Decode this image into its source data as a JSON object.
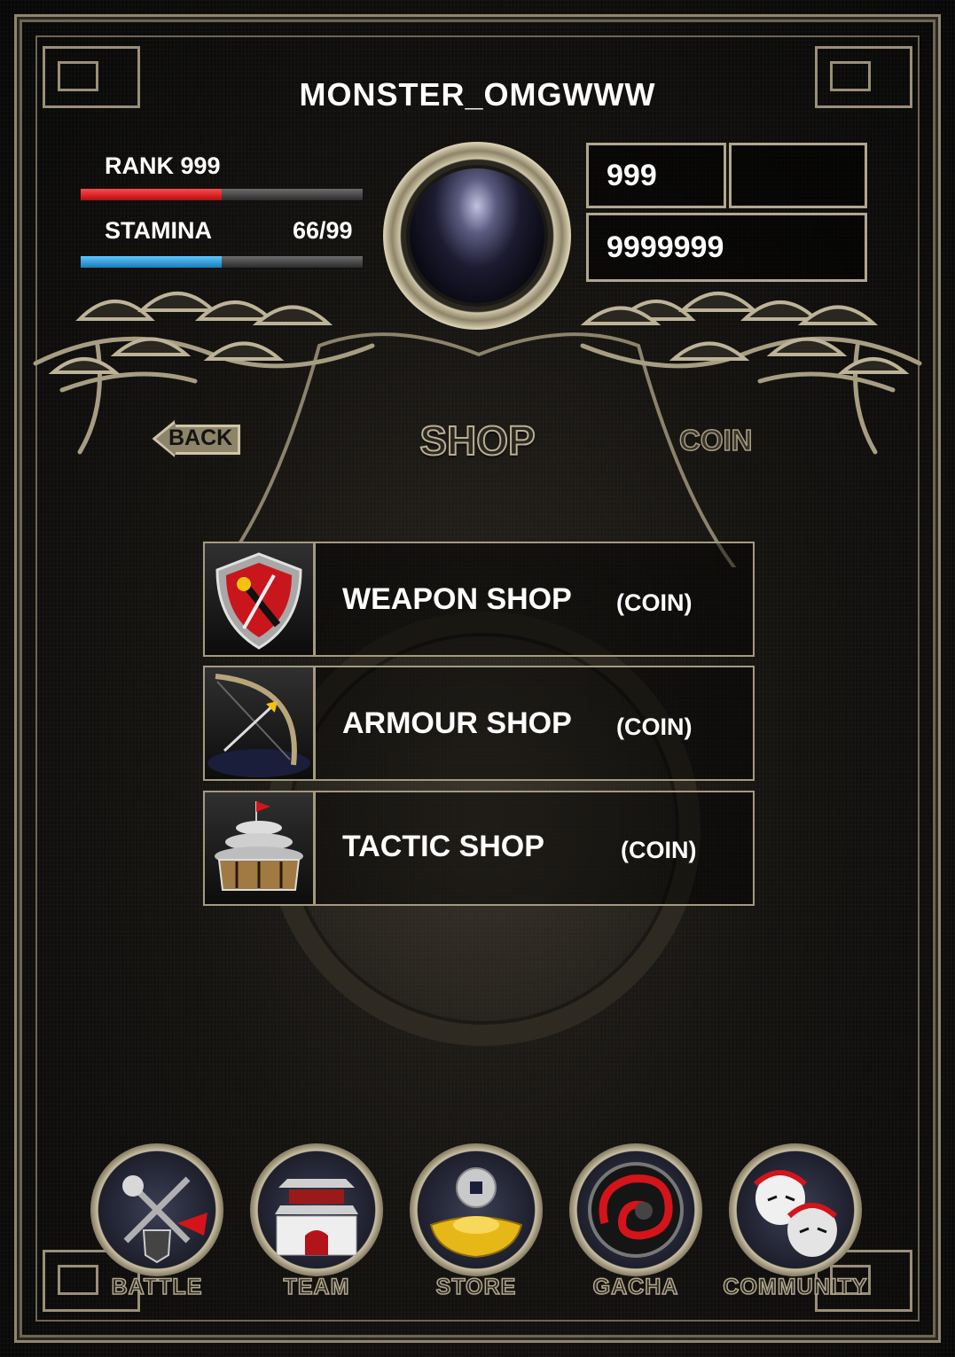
{
  "player": {
    "name": "MONSTER_OMGWWW",
    "rank_label": "RANK 999",
    "rank_progress": 0.5,
    "stamina_label": "STAMINA",
    "stamina_value": "66/99",
    "stamina_progress": 0.5
  },
  "currency": {
    "value_1": "999",
    "value_2": "9999999"
  },
  "header": {
    "back_label": "BACK",
    "title": "SHOP",
    "coin_label": "COIN"
  },
  "shops": [
    {
      "name": "WEAPON SHOP",
      "currency": "(COIN)",
      "icon": "shield-sword-icon"
    },
    {
      "name": "ARMOUR SHOP",
      "currency": "(COIN)",
      "icon": "bow-arrow-icon"
    },
    {
      "name": "TACTIC SHOP",
      "currency": "(COIN)",
      "icon": "temple-icon"
    }
  ],
  "nav": [
    {
      "label": "BATTLE",
      "icon": "battle-weapons-icon"
    },
    {
      "label": "TEAM",
      "icon": "fortress-icon"
    },
    {
      "label": "STORE",
      "icon": "gold-ingot-icon"
    },
    {
      "label": "GACHA",
      "icon": "dragon-icon"
    },
    {
      "label": "COMMUNITY",
      "icon": "masks-icon"
    }
  ],
  "colors": {
    "rank_bar": "#e2151c",
    "stamina_bar": "#27a3e0",
    "frame_gold": "#a49a80"
  }
}
